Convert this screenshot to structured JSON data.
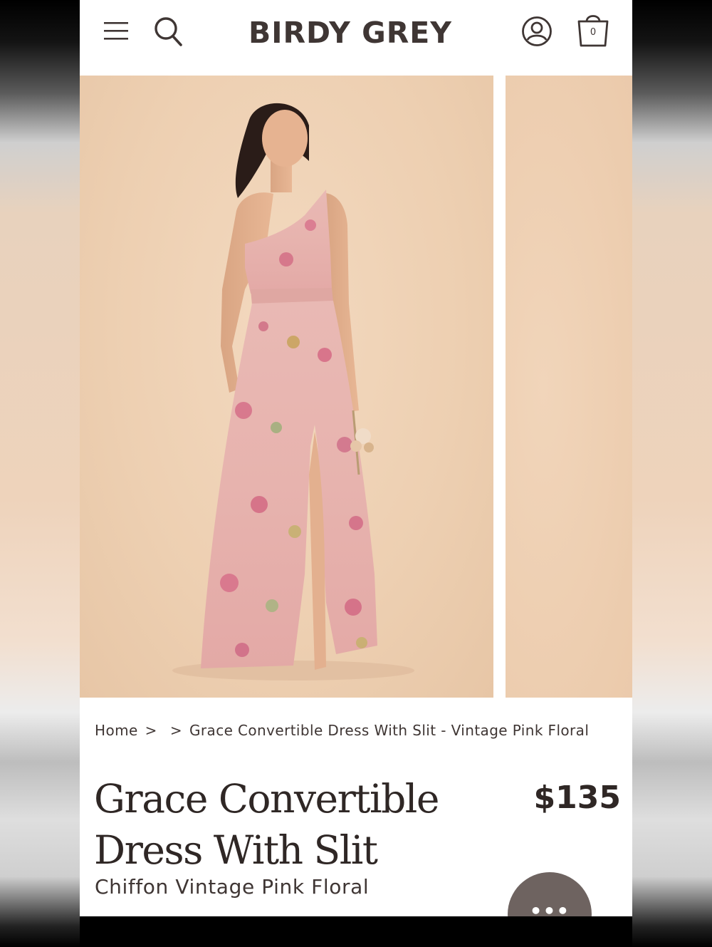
{
  "header": {
    "brand": "BIRDY GREY",
    "cart_count": "0"
  },
  "icons": {
    "menu": "hamburger-menu-icon",
    "search": "search-icon",
    "account": "account-icon",
    "cart": "shopping-bag-icon",
    "chat": "chat-icon"
  },
  "gallery": {
    "main_image": "Model wearing floral one-shoulder maxi dress",
    "next_image": "Next product image"
  },
  "breadcrumb": {
    "home": "Home",
    "sep1": ">",
    "sep2": ">",
    "current": "Grace Convertible Dress With Slit - Vintage Pink Floral"
  },
  "product": {
    "title_line1": "Grace Convertible",
    "title_line2": "Dress With Slit",
    "price": "$135",
    "subtitle": "Chiffon Vintage Pink Floral"
  },
  "chat": {
    "dots": "•••"
  },
  "colors": {
    "text_dark": "#2f2725",
    "brand_text": "#3f3634",
    "photo_bg": "#edcfb1",
    "chat_bg": "#6e6360"
  }
}
